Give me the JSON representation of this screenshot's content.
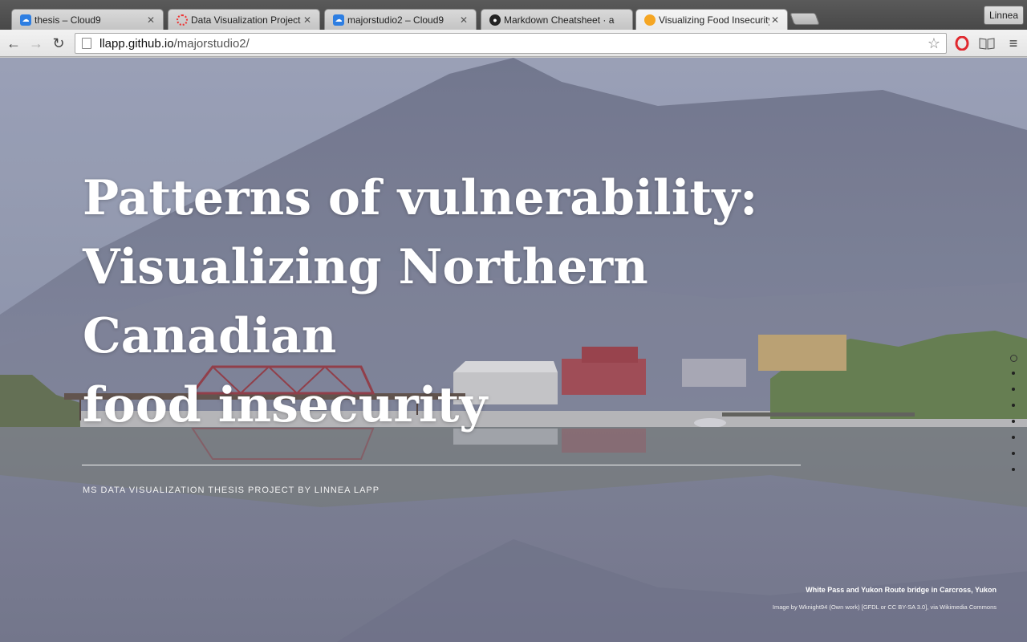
{
  "browser": {
    "tabs": [
      {
        "title": "thesis – Cloud9",
        "icon": "cloud9-icon",
        "color": "#2d7ee2"
      },
      {
        "title": "Data Visualization Project",
        "icon": "loading-icon",
        "color": "#e33"
      },
      {
        "title": "majorstudio2 – Cloud9",
        "icon": "cloud9-icon",
        "color": "#2d7ee2"
      },
      {
        "title": "Markdown Cheatsheet · ad",
        "icon": "github-icon",
        "color": "#222"
      },
      {
        "title": "Visualizing Food Insecurity",
        "icon": "orange-circle-icon",
        "color": "#f5a623"
      }
    ],
    "profile_name": "Linnea",
    "url_host": "llapp.github.io",
    "url_path": "/majorstudio2/"
  },
  "hero": {
    "title_line1": "Patterns of vulnerability:",
    "title_line2": "Visualizing Northern Canadian",
    "title_line3": "food insecurity",
    "byline": "MS DATA VISUALIZATION THESIS PROJECT BY LINNEA LAPP"
  },
  "photo": {
    "caption": "White Pass and Yukon Route bridge in Carcross, Yukon",
    "credit": "Image by Wknight94 (Own work) [GFDL or CC BY-SA 3.0], via Wikimedia Commons"
  }
}
